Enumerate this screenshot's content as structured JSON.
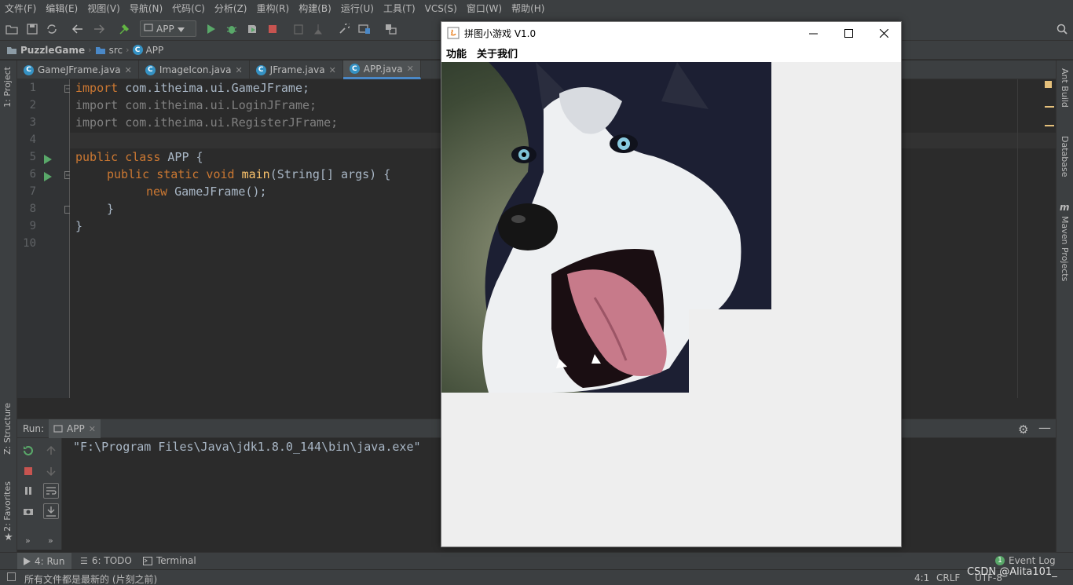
{
  "menubar": {
    "items": [
      "文件(F)",
      "编辑(E)",
      "视图(V)",
      "导航(N)",
      "代码(C)",
      "分析(Z)",
      "重构(R)",
      "构建(B)",
      "运行(U)",
      "工具(T)",
      "VCS(S)",
      "窗口(W)",
      "帮助(H)"
    ]
  },
  "toolbar": {
    "run_config": "APP"
  },
  "breadcrumb": {
    "project": "PuzzleGame",
    "folder": "src",
    "file": "APP"
  },
  "left_stripe": {
    "project": "1: Project",
    "structure": "Z: Structure",
    "favorites": "2: Favorites"
  },
  "right_stripe": {
    "ant": "Ant Build",
    "database": "Database",
    "maven": "Maven Projects"
  },
  "tabs": [
    {
      "label": "GameJFrame.java",
      "active": false
    },
    {
      "label": "ImageIcon.java",
      "active": false
    },
    {
      "label": "JFrame.java",
      "active": false
    },
    {
      "label": "APP.java",
      "active": true
    }
  ],
  "editor": {
    "line_numbers": [
      "1",
      "2",
      "3",
      "4",
      "5",
      "6",
      "7",
      "8",
      "9",
      "10"
    ],
    "lines": {
      "l1_kw": "import",
      "l1_rest": " com.itheima.ui.GameJFrame;",
      "l2": "import com.itheima.ui.LoginJFrame;",
      "l3": "import com.itheima.ui.RegisterJFrame;",
      "l5_kw": "public class",
      "l5_rest": " APP {",
      "l6_kw": "public static void",
      "l6_fn": "main",
      "l6_rest": "(String[] args) {",
      "l7_kw": "new",
      "l7_rest": " GameJFrame();",
      "l8": "}",
      "l9": "}"
    }
  },
  "run_panel": {
    "label": "Run:",
    "tab": "APP",
    "console_line": "\"F:\\Program Files\\Java\\jdk1.8.0_144\\bin\\java.exe\""
  },
  "bottom_tabs": {
    "run": "4: Run",
    "todo": "6: TODO",
    "terminal": "Terminal",
    "event_log": "Event Log",
    "event_count": "1"
  },
  "statusbar": {
    "message": "所有文件都是最新的 (片刻之前)",
    "position": "4:1",
    "line_sep": "CRLF",
    "encoding": "UTF-8",
    "watermark": "CSDN @Alita101_"
  },
  "game_window": {
    "title": "拼图小游戏 V1.0",
    "menu": [
      "功能",
      "关于我们"
    ]
  },
  "colors": {
    "accent": "#4a88c7",
    "keyword": "#cc7832",
    "function": "#ffc66d",
    "text": "#a9b7c6"
  }
}
